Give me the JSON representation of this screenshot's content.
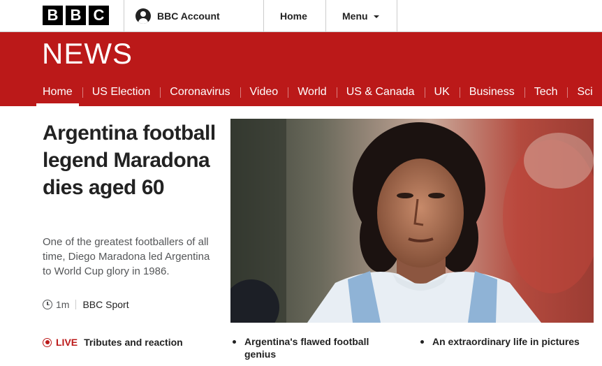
{
  "header": {
    "logo_letters": [
      "B",
      "B",
      "C"
    ],
    "account_label": "BBC Account",
    "account_icon": "user-icon",
    "home_label": "Home",
    "menu_label": "Menu",
    "menu_icon": "chevron-down-icon"
  },
  "news": {
    "logo": "NEWS",
    "brand_color": "#bb1919",
    "nav": [
      {
        "label": "Home",
        "active": true
      },
      {
        "label": "US Election"
      },
      {
        "label": "Coronavirus"
      },
      {
        "label": "Video"
      },
      {
        "label": "World"
      },
      {
        "label": "US & Canada"
      },
      {
        "label": "UK"
      },
      {
        "label": "Business"
      },
      {
        "label": "Tech"
      },
      {
        "label": "Sci"
      }
    ]
  },
  "lead": {
    "headline": "Argentina football legend Maradona dies aged 60",
    "summary": "One of the greatest footballers of all time, Diego Maradona led Argentina to World Cup glory in 1986.",
    "time_icon": "clock-icon",
    "time": "1m",
    "source": "BBC Sport",
    "image": "hero-photo"
  },
  "related": {
    "live_icon": "live-icon",
    "live_label": "LIVE",
    "live_title": "Tributes and reaction",
    "links": [
      "Argentina's flawed football genius",
      "An extraordinary life in pictures"
    ]
  }
}
